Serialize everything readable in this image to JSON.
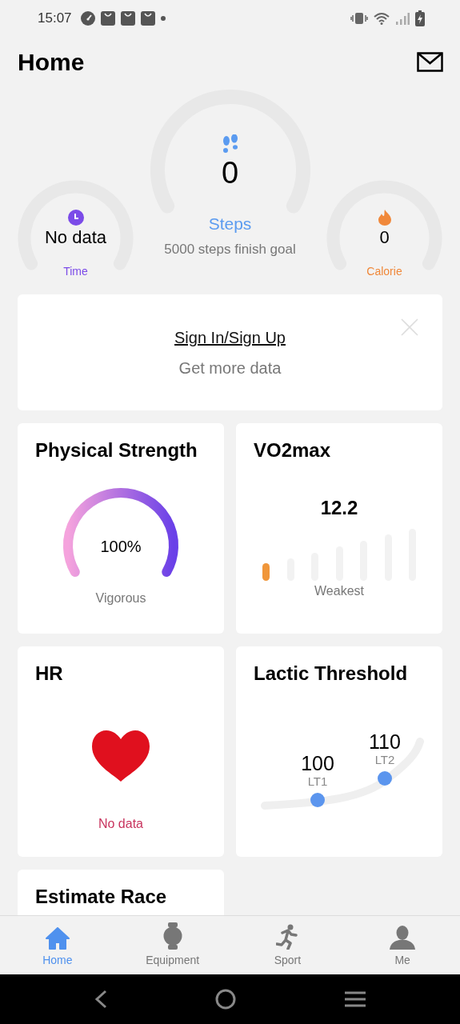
{
  "status_bar": {
    "time": "15:07"
  },
  "header": {
    "title": "Home"
  },
  "gauges": [
    {
      "kind": "small",
      "value": "No data",
      "label": "Time",
      "color": "#7b4be8"
    },
    {
      "kind": "large",
      "value": "0",
      "label": "Steps",
      "caption": "5000 steps finish goal",
      "color": "#5b9bf0"
    },
    {
      "kind": "small",
      "value": "0",
      "label": "Calorie",
      "color": "#f0883a"
    }
  ],
  "login_card": {
    "link": "Sign In/Sign Up",
    "text": "Get more data"
  },
  "cards": [
    {
      "kind": "strength",
      "title": "Physical Strength",
      "value": "100%",
      "caption": "Vigorous"
    },
    {
      "kind": "vo2max",
      "title": "VO2max",
      "value": "12.2",
      "scale": [
        {
          "selected": true
        },
        {
          "selected": false
        },
        {
          "selected": false
        },
        {
          "selected": false
        },
        {
          "selected": false
        },
        {
          "selected": false
        },
        {
          "selected": false
        }
      ],
      "caption": "Weakest"
    },
    {
      "kind": "hr",
      "title": "HR",
      "caption": "No data"
    },
    {
      "kind": "lactic",
      "title": "Lactic Threshold",
      "points": [
        {
          "value": "100",
          "label": "LT1"
        },
        {
          "value": "110",
          "label": "LT2"
        }
      ]
    },
    {
      "kind": "race",
      "title": "Estimate Race"
    }
  ],
  "tabs": [
    {
      "label": "Home",
      "selected": true
    },
    {
      "label": "Equipment",
      "selected": false
    },
    {
      "label": "Sport",
      "selected": false
    },
    {
      "label": "Me",
      "selected": false
    }
  ]
}
